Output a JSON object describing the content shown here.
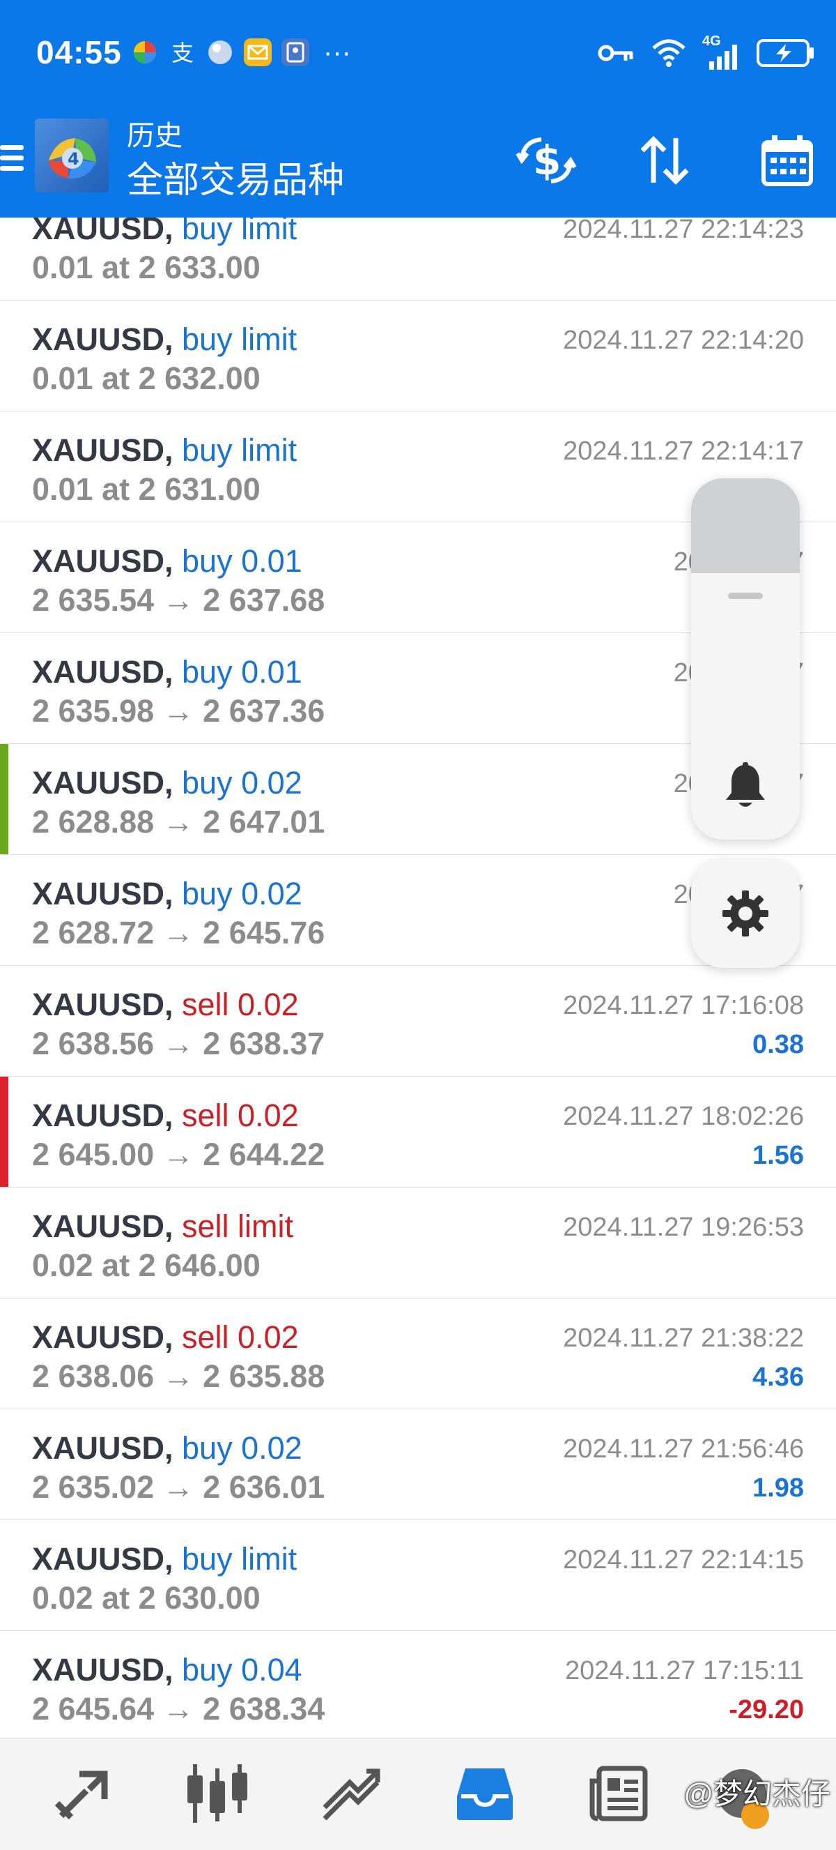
{
  "status_bar": {
    "time": "04:55",
    "left_icons": [
      "pinwheel-app-icon",
      "alipay-icon",
      "ball-app-icon",
      "mail-app-icon",
      "id-card-app-icon"
    ],
    "more": "···",
    "network": "4G",
    "right_icons": [
      "key-icon",
      "wifi-icon",
      "signal-icon",
      "battery-charging-icon"
    ]
  },
  "app_bar": {
    "subtitle": "历史",
    "title": "全部交易品种",
    "actions": [
      "currency-exchange-icon",
      "sort-icon",
      "calendar-icon"
    ]
  },
  "colors": {
    "header": "#0a78e8",
    "buy": "#1a73d1",
    "sell": "#cc1f25",
    "marker_green": "#6aaa1a",
    "marker_red": "#e0202a"
  },
  "trades": [
    {
      "symbol": "XAUUSD,",
      "type": " buy limit",
      "side": "buy",
      "detail": "0.01 at 2 633.00",
      "time": "2024.11.27 22:14:23",
      "profit": "",
      "marker": ""
    },
    {
      "symbol": "XAUUSD,",
      "type": " buy limit",
      "side": "buy",
      "detail": "0.01 at 2 632.00",
      "time": "2024.11.27 22:14:20",
      "profit": "",
      "marker": ""
    },
    {
      "symbol": "XAUUSD,",
      "type": " buy limit",
      "side": "buy",
      "detail": "0.01 at 2 631.00",
      "time": "2024.11.27 22:14:17",
      "profit": "",
      "marker": ""
    },
    {
      "symbol": "XAUUSD,",
      "type": " buy 0.01",
      "side": "buy",
      "detail": "2 635.54 → 2 637.68",
      "time": "2024.11.27",
      "profit": "",
      "marker": ""
    },
    {
      "symbol": "XAUUSD,",
      "type": " buy 0.01",
      "side": "buy",
      "detail": "2 635.98 → 2 637.36",
      "time": "2024.11.27",
      "profit": "",
      "marker": ""
    },
    {
      "symbol": "XAUUSD,",
      "type": " buy 0.02",
      "side": "buy",
      "detail": "2 628.88 → 2 647.01",
      "time": "2024.11.27",
      "profit": "",
      "marker": "green"
    },
    {
      "symbol": "XAUUSD,",
      "type": " buy 0.02",
      "side": "buy",
      "detail": "2 628.72 → 2 645.76",
      "time": "2024.11.27",
      "profit": "",
      "marker": ""
    },
    {
      "symbol": "XAUUSD,",
      "type": " sell 0.02",
      "side": "sell",
      "detail": "2 638.56 → 2 638.37",
      "time": "2024.11.27 17:16:08",
      "profit": "0.38",
      "marker": ""
    },
    {
      "symbol": "XAUUSD,",
      "type": " sell 0.02",
      "side": "sell",
      "detail": "2 645.00 → 2 644.22",
      "time": "2024.11.27 18:02:26",
      "profit": "1.56",
      "marker": "red"
    },
    {
      "symbol": "XAUUSD,",
      "type": " sell limit",
      "side": "sell",
      "detail": "0.02 at 2 646.00",
      "time": "2024.11.27 19:26:53",
      "profit": "",
      "marker": ""
    },
    {
      "symbol": "XAUUSD,",
      "type": " sell 0.02",
      "side": "sell",
      "detail": "2 638.06 → 2 635.88",
      "time": "2024.11.27 21:38:22",
      "profit": "4.36",
      "marker": ""
    },
    {
      "symbol": "XAUUSD,",
      "type": " buy 0.02",
      "side": "buy",
      "detail": "2 635.02 → 2 636.01",
      "time": "2024.11.27 21:56:46",
      "profit": "1.98",
      "marker": ""
    },
    {
      "symbol": "XAUUSD,",
      "type": " buy limit",
      "side": "buy",
      "detail": "0.02 at 2 630.00",
      "time": "2024.11.27 22:14:15",
      "profit": "",
      "marker": ""
    },
    {
      "symbol": "XAUUSD,",
      "type": " buy 0.04",
      "side": "buy",
      "detail": "2 645.64 → 2 638.34",
      "time": "2024.11.27 17:15:11",
      "profit": "-29.20",
      "marker": ""
    }
  ],
  "floating_widget": {
    "icons": [
      "bell-icon",
      "gear-icon"
    ]
  },
  "bottom_nav": {
    "items": [
      "quotes-icon",
      "chart-icon",
      "trade-icon",
      "history-icon",
      "news-icon",
      "chat-icon"
    ],
    "active": "history-icon",
    "watermark": "@梦幻杰仔"
  }
}
